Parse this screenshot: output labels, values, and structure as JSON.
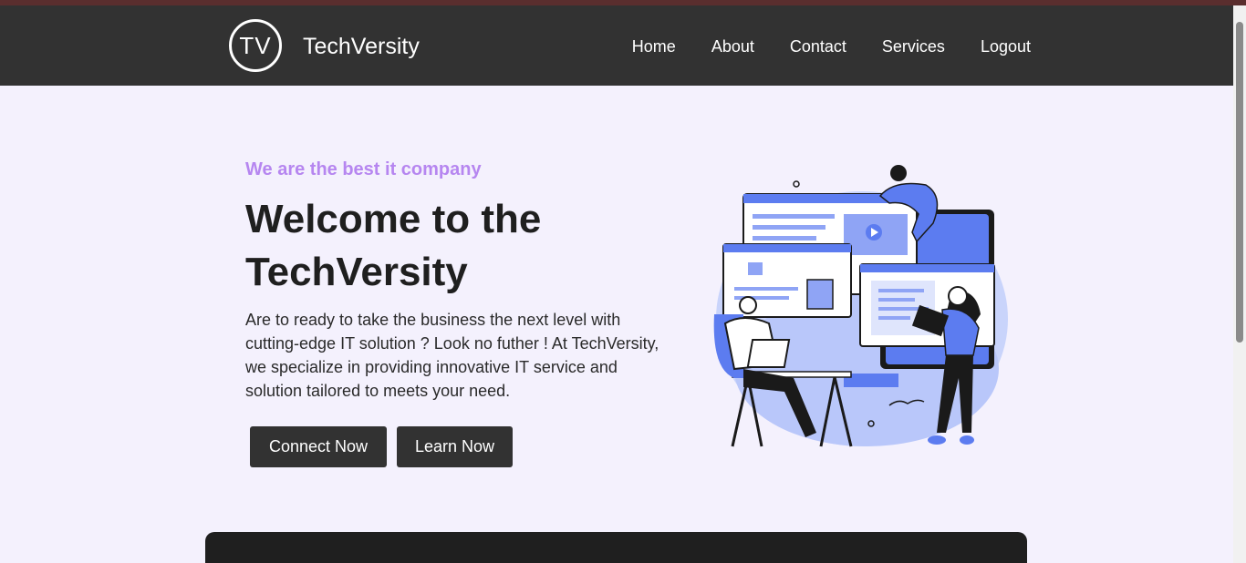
{
  "header": {
    "logo_text": "TV",
    "brand": "TechVersity",
    "nav": [
      "Home",
      "About",
      "Contact",
      "Services",
      "Logout"
    ]
  },
  "hero": {
    "tagline": "We are the best it company",
    "title": "Welcome to the TechVersity",
    "description": "Are to ready to take the business the next level with cutting-edge IT solution ? Look no futher ! At TechVersity, we specialize in providing innovative IT service and solution tailored to meets your need.",
    "buttons": {
      "connect": "Connect Now",
      "learn": "Learn Now"
    },
    "illustration": "team-working-illustration"
  },
  "colors": {
    "navbar": "#323232",
    "background": "#f4f1fd",
    "accent_purple": "#b686f0",
    "illustration_blue": "#5c7cf0"
  }
}
